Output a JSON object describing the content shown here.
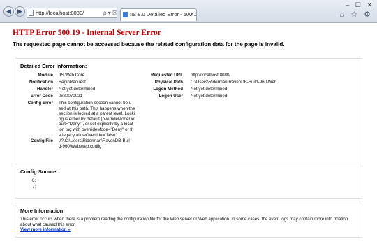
{
  "browser": {
    "address": "http://localhost:8080/",
    "address_tools": "ρ ▾ ☒ ✕",
    "tab_title": "IIS 8.0 Detailed Error - 500.1...",
    "tab_close": "✕",
    "window_controls": "–  ☐  ✕",
    "right_tools": "⌂ ☆ ⚙",
    "icons": [
      "back-icon",
      "forward-icon",
      "page-icon",
      "home-icon",
      "star-icon",
      "gear-icon"
    ]
  },
  "header": {
    "title": "HTTP Error 500.19 - Internal Server Error",
    "subtitle": "The requested page cannot be accessed because the related configuration data for the page is invalid."
  },
  "detailed": {
    "heading": "Detailed Error Information:",
    "left": [
      {
        "label": "Module",
        "value": "IIS Web Core"
      },
      {
        "label": "Notification",
        "value": "BeginRequest"
      },
      {
        "label": "Handler",
        "value": "Not yet determined"
      },
      {
        "label": "Error Code",
        "value": "0x80070021"
      }
    ],
    "config_error_label": "Config Error",
    "config_error_lines": [
      "This configuration section cannot be u",
      "sed at this path. This happens when the",
      "section is locked at a parent level. Locki",
      "ng is either by default (overrideModeDef",
      "ault=\"Deny\"), or set explicitly by a locat",
      "ion tag with overrideMode=\"Deny\" or th",
      "e legacy allowOverride=\"false\"."
    ],
    "config_file_label": "Config File",
    "config_file_lines": [
      "\\\\?\\C:\\Users\\Riderman\\RavenDB-Buil",
      "d-960\\Web\\web.config"
    ],
    "right": [
      {
        "label": "Requested URL",
        "value": "http://localhost:8080/"
      },
      {
        "label": "Physical Path",
        "value": "C:\\Users\\Riderman\\RavenDB-Build-960\\Web"
      },
      {
        "label": "Logon Method",
        "value": "Not yet determined"
      },
      {
        "label": "Logon User",
        "value": "Not yet determined"
      }
    ]
  },
  "config_source": {
    "heading": "Config Source:",
    "lines": [
      "6:",
      "7:"
    ]
  },
  "more_info": {
    "heading": "More Information:",
    "text": "This error occurs when there is a problem reading the configuration file for the Web server or Web application. In some cases, the event logs may contain more info rmation about what caused this error.",
    "link": "View more information »"
  }
}
